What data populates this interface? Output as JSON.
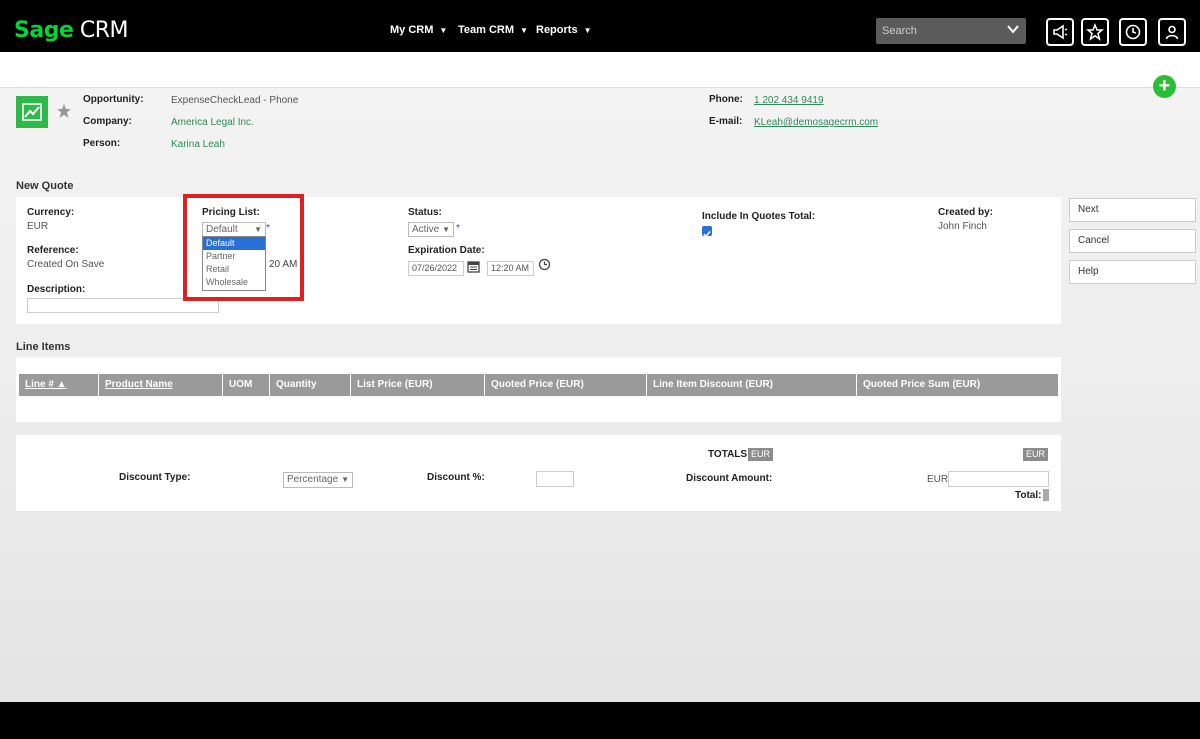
{
  "app": {
    "logo_brand": "Sage",
    "logo_product": "CRM"
  },
  "nav": {
    "my_crm": "My CRM",
    "team_crm": "Team CRM",
    "reports": "Reports"
  },
  "search": {
    "placeholder": "Search"
  },
  "header_icons": [
    "megaphone-icon",
    "favorites-star-icon",
    "recent-clock-icon",
    "user-profile-icon"
  ],
  "opportunity": {
    "opportunity_label": "Opportunity:",
    "opportunity_value": "ExpenseCheckLead - Phone",
    "company_label": "Company:",
    "company_value": "America Legal Inc.",
    "person_label": "Person:",
    "person_value": "Karina Leah",
    "phone_label": "Phone:",
    "phone_value": "1 202 434 9419",
    "email_label": "E-mail:",
    "email_value": "KLeah@demosagecrm.com"
  },
  "new_quote": {
    "title": "New Quote",
    "currency_label": "Currency:",
    "currency_value": "EUR",
    "pricing_label": "Pricing List:",
    "pricing_selected": "Default",
    "pricing_options": [
      "Default",
      "Partner",
      "Retail",
      "Wholesale"
    ],
    "status_label": "Status:",
    "status_value": "Active",
    "include_label": "Include In Quotes Total:",
    "created_by_label": "Created by:",
    "created_by_value": "John Finch",
    "reference_label": "Reference:",
    "reference_value": "Created On Save",
    "hidden_time_fragment": "20 AM",
    "expiration_label": "Expiration Date:",
    "expiration_date": "07/26/2022",
    "expiration_time": "12:20 AM",
    "description_label": "Description:",
    "required_mark": "*"
  },
  "actions": {
    "next": "Next",
    "cancel": "Cancel",
    "help": "Help"
  },
  "line_items": {
    "title": "Line Items",
    "columns": [
      "Line # ▲",
      "Product Name",
      "UOM",
      "Quantity",
      "List Price (EUR)",
      "Quoted Price (EUR)",
      "Line Item Discount (EUR)",
      "Quoted Price Sum (EUR)"
    ]
  },
  "totals": {
    "totals_label": "TOTALS",
    "currency_badge": "EUR",
    "currency_badge_right": "EUR",
    "discount_type_label": "Discount Type:",
    "discount_type_value": "Percentage",
    "discount_pct_label": "Discount %:",
    "discount_amount_label": "Discount Amount:",
    "discount_amount_currency": "EUR",
    "total_label": "Total:"
  },
  "colors": {
    "brand_green": "#00d639",
    "highlight_red": "#e02020",
    "link_green": "#2e8b57",
    "selected_blue": "#2a6fd6"
  }
}
